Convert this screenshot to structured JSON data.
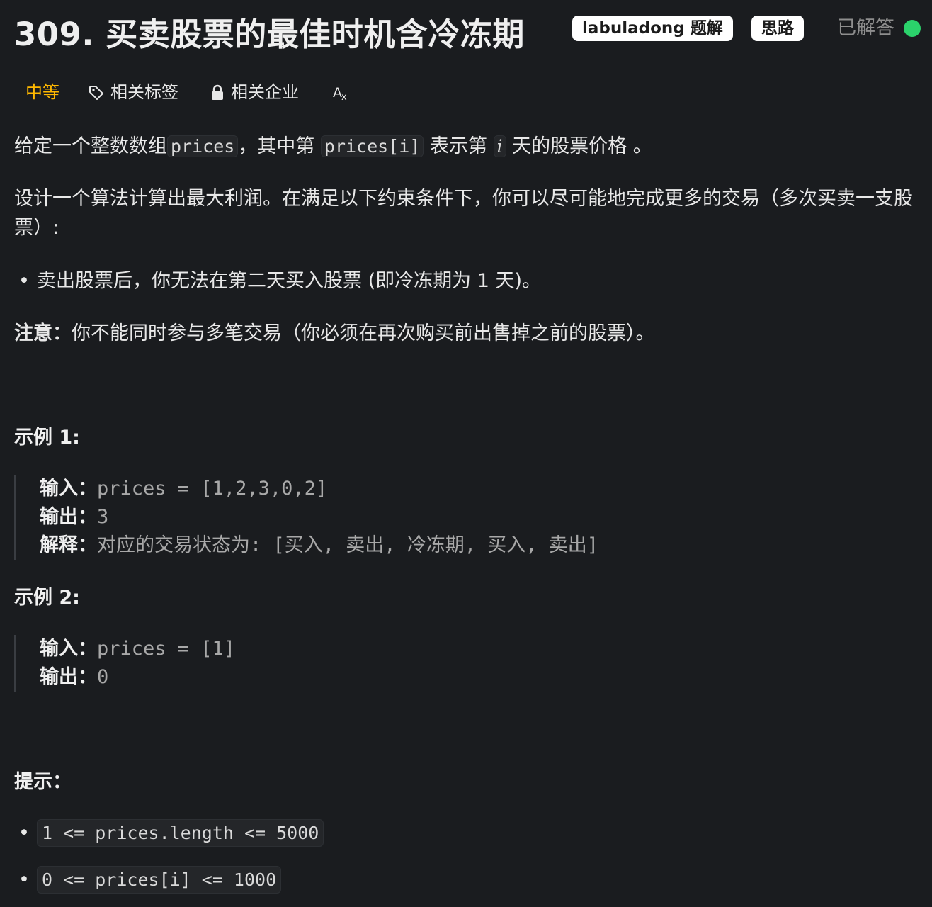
{
  "header": {
    "title": "309. 买卖股票的最佳时机含冷冻期",
    "solution_button": "labuladong 题解",
    "idea_button": "思路",
    "solved_status": "已解答"
  },
  "tags": {
    "difficulty": "中等",
    "related_tags": "相关标签",
    "related_companies": "相关企业",
    "translate_icon": "translate-icon"
  },
  "description": {
    "p1_a": "给定一个整数数组",
    "p1_code1": "prices",
    "p1_b": "，其中第 ",
    "p1_code2": "prices[i]",
    "p1_c": " 表示第 ",
    "p1_var": "i",
    "p1_d": " 天的股票价格 。",
    "p2": "设计一个算法计算出最大利润。在满足以下约束条件下，你可以尽可能地完成更多的交易（多次买卖一支股票）:",
    "bullet1": "卖出股票后，你无法在第二天买入股票 (即冷冻期为 1 天)。",
    "note_label": "注意：",
    "note_text": "你不能同时参与多笔交易（你必须在再次购买前出售掉之前的股票）。"
  },
  "example1": {
    "heading": "示例 1:",
    "input_label": "输入：",
    "input_value": "prices = [1,2,3,0,2]",
    "output_label": "输出：",
    "output_value": "3",
    "explain_label": "解释：",
    "explain_value": "对应的交易状态为: [买入, 卖出, 冷冻期, 买入, 卖出]"
  },
  "example2": {
    "heading": "示例 2:",
    "input_label": "输入：",
    "input_value": "prices = [1]",
    "output_label": "输出：",
    "output_value": "0"
  },
  "hints": {
    "heading": "提示：",
    "items": [
      "1 <= prices.length <= 5000",
      "0 <= prices[i] <= 1000"
    ]
  },
  "colors": {
    "background": "#1a1c1f",
    "difficulty": "#ffb800",
    "solved_dot": "#2bd26b"
  }
}
